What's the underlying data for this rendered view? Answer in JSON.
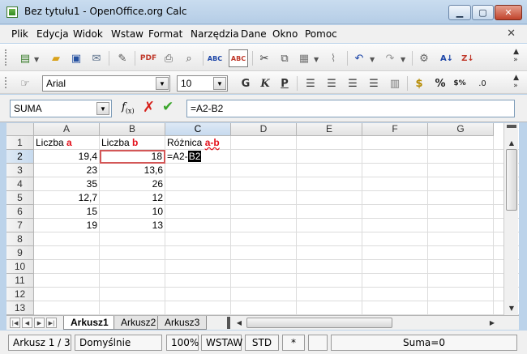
{
  "window": {
    "title": "Bez tytułu1 - OpenOffice.org Calc"
  },
  "menu": [
    "Plik",
    "Edycja",
    "Widok",
    "Wstaw",
    "Format",
    "Narzędzia",
    "Dane",
    "Okno",
    "Pomoc"
  ],
  "toolbar_format": {
    "font_name": "Arial",
    "font_size": "10"
  },
  "formula_bar": {
    "name_box": "SUMA",
    "formula": "=A2-B2"
  },
  "grid": {
    "columns": [
      "A",
      "B",
      "C",
      "D",
      "E",
      "F",
      "G"
    ],
    "rows": [
      "1",
      "2",
      "3",
      "4",
      "5",
      "6",
      "7",
      "8",
      "9",
      "10",
      "11",
      "12",
      "13"
    ],
    "header_row": {
      "a1_prefix": "Liczba ",
      "a1_var": "a",
      "b1_prefix": "Liczba ",
      "b1_var": "b",
      "c1_prefix": "Różnica ",
      "c1_var": "a-b"
    },
    "data": [
      {
        "a": "19,4",
        "b": "18",
        "c_prefix": "=A2-",
        "c_ref": "B2"
      },
      {
        "a": "23",
        "b": "13,6"
      },
      {
        "a": "35",
        "b": "26"
      },
      {
        "a": "12,7",
        "b": "12"
      },
      {
        "a": "15",
        "b": "10"
      },
      {
        "a": "19",
        "b": "13"
      }
    ]
  },
  "sheets": [
    "Arkusz1",
    "Arkusz2",
    "Arkusz3"
  ],
  "status": {
    "sheet": "Arkusz 1 / 3",
    "style": "Domyślnie",
    "zoom": "100%",
    "insert_mode": "WSTAW",
    "selection_mode": "STD",
    "modified": "*",
    "sum": "Suma=0"
  }
}
